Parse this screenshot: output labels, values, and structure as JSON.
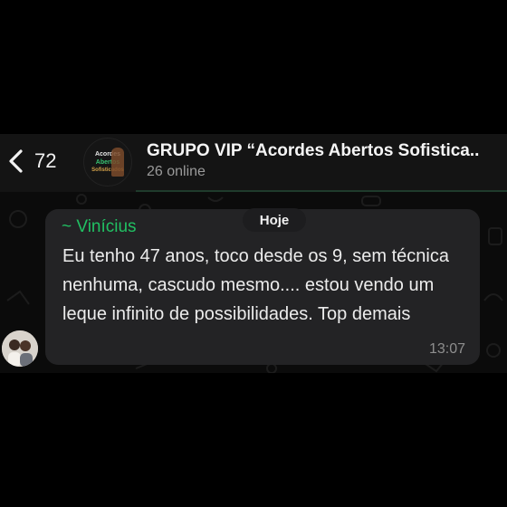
{
  "header": {
    "back_count": "72",
    "group_title": "GRUPO VIP “Acordes Abertos Sofistica..",
    "online_status": "26 online",
    "avatar_lines": [
      "Acordes",
      "Abertos",
      "Sofisticados"
    ]
  },
  "chat": {
    "date_label": "Hoje",
    "message": {
      "sender": "~ Vinícius",
      "text": "Eu tenho 47 anos, toco desde os 9, sem técnica nenhuma, cascudo mesmo.... estou vendo um leque infinito de possibilidades. Top demais",
      "time": "13:07"
    }
  },
  "colors": {
    "accent_green": "#21c063",
    "bubble": "#232325",
    "background": "#000000"
  },
  "icons": [
    "chevron-left-icon"
  ]
}
